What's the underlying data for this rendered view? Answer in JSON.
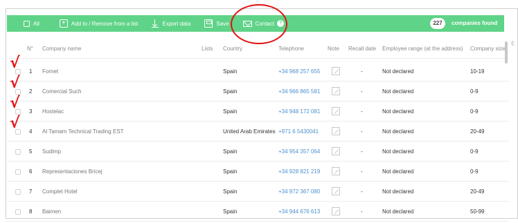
{
  "toolbar": {
    "all_label": "All",
    "add_remove_label": "Add to / Remove from a list",
    "export_label": "Export data",
    "save_label": "Save",
    "contact_label": "Contact",
    "help_glyph": "?",
    "plus_glyph": "+",
    "count": "227",
    "count_label": "companies found"
  },
  "table": {
    "headers": [
      "N°",
      "Company name",
      "Lists",
      "Country",
      "Telephone",
      "Note",
      "Recall date",
      "Employee range (at the address)",
      "Company size"
    ],
    "rows": [
      {
        "n": "1",
        "name": "Fornet",
        "country": "Spain",
        "phone": "+34 968 257 655",
        "recall": "-",
        "employees": "Not declared",
        "size": "10-19"
      },
      {
        "n": "2",
        "name": "Comercial Such",
        "country": "Spain",
        "phone": "+34 966 865 581",
        "recall": "-",
        "employees": "Not declared",
        "size": "0-9"
      },
      {
        "n": "3",
        "name": "Hostelac",
        "country": "Spain",
        "phone": "+34 948 172 081",
        "recall": "-",
        "employees": "Not declared",
        "size": "0-9"
      },
      {
        "n": "4",
        "name": "Al Tamam Technical Trading EST",
        "country": "United Arab Emirates",
        "phone": "+971 6 5430041",
        "recall": "-",
        "employees": "Not declared",
        "size": "20-49"
      },
      {
        "n": "5",
        "name": "Sudimp",
        "country": "Spain",
        "phone": "+34 954 357 064",
        "recall": "-",
        "employees": "Not declared",
        "size": "0-9"
      },
      {
        "n": "6",
        "name": "Representaciones Bricej",
        "country": "Spain",
        "phone": "+34 928 821 219",
        "recall": "-",
        "employees": "Not declared",
        "size": "0-9"
      },
      {
        "n": "7",
        "name": "Complet Hotel",
        "country": "Spain",
        "phone": "+34 972 367 080",
        "recall": "-",
        "employees": "Not declared",
        "size": "20-49"
      },
      {
        "n": "8",
        "name": "Baimen",
        "country": "Spain",
        "phone": "+34 944 676 613",
        "recall": "-",
        "employees": "Not declared",
        "size": "50-99"
      }
    ]
  },
  "annotations": {
    "check_glyph": "√",
    "checked_rows": [
      1,
      2,
      3,
      4
    ]
  },
  "colors": {
    "toolbar_bg": "#5fd387",
    "annotation_red": "#e01010",
    "phone_link": "#4a8fd0"
  },
  "corner_icon": "€"
}
